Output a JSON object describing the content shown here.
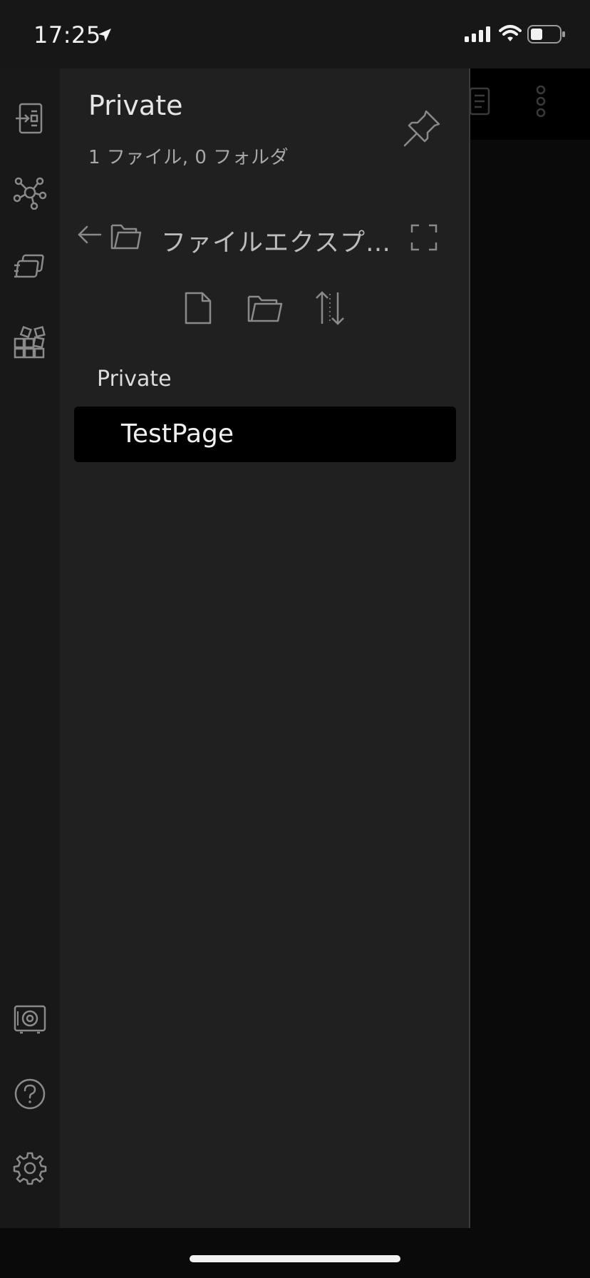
{
  "status_bar": {
    "time": "17:25"
  },
  "drawer": {
    "vault_name": "Private",
    "vault_stats": "1 ファイル, 0 フォルダ",
    "view_title": "ファイルエクスプローラ",
    "tree": {
      "root_label": "Private",
      "files": [
        {
          "label": "TestPage"
        }
      ]
    }
  },
  "ribbon": {
    "top_icons": [
      "open-quick-switcher-icon",
      "graph-view-icon",
      "slides-icon",
      "plugins-icon"
    ],
    "bottom_icons": [
      "vault-switch-icon",
      "help-icon",
      "settings-icon"
    ]
  },
  "icons": {
    "pin": "pin-icon",
    "back": "arrow-left-icon",
    "folder": "folder-icon",
    "expand": "expand-icon",
    "new_note": "new-note-icon",
    "new_folder": "new-folder-icon",
    "sort": "sort-icon"
  },
  "colors": {
    "ribbon_bg": "#181818",
    "drawer_bg": "#202020",
    "selected_file_bg": "#000000",
    "icon_stroke": "#8a8a8a"
  }
}
